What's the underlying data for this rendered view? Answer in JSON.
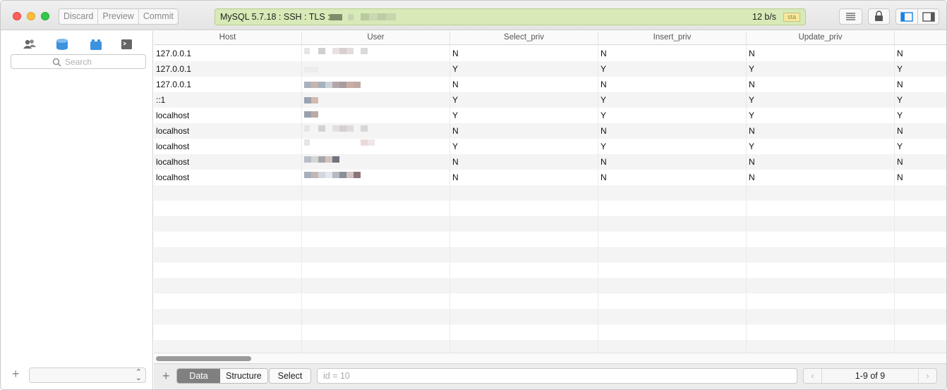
{
  "toolbar": {
    "discard": "Discard",
    "preview": "Preview",
    "commit": "Commit"
  },
  "status": {
    "connection": "MySQL 5.7.18 : SSH : TLS :",
    "speed": "12 b/s",
    "badge": "sta"
  },
  "sidebar": {
    "search_placeholder": "Search",
    "icons": [
      "users-icon",
      "database-icon",
      "lego-icon",
      "terminal-icon"
    ]
  },
  "table": {
    "columns": [
      "Host",
      "User",
      "Select_priv",
      "Insert_priv",
      "Update_priv"
    ],
    "rows": [
      {
        "host": "127.0.0.1",
        "select": "N",
        "insert": "N",
        "update": "N",
        "next": "N"
      },
      {
        "host": "127.0.0.1",
        "select": "Y",
        "insert": "Y",
        "update": "Y",
        "next": "Y"
      },
      {
        "host": "127.0.0.1",
        "select": "N",
        "insert": "N",
        "update": "N",
        "next": "N"
      },
      {
        "host": "::1",
        "select": "Y",
        "insert": "Y",
        "update": "Y",
        "next": "Y"
      },
      {
        "host": "localhost",
        "select": "Y",
        "insert": "Y",
        "update": "Y",
        "next": "Y"
      },
      {
        "host": "localhost",
        "select": "N",
        "insert": "N",
        "update": "N",
        "next": "N"
      },
      {
        "host": "localhost",
        "select": "Y",
        "insert": "Y",
        "update": "Y",
        "next": "Y"
      },
      {
        "host": "localhost",
        "select": "N",
        "insert": "N",
        "update": "N",
        "next": "N"
      },
      {
        "host": "localhost",
        "select": "N",
        "insert": "N",
        "update": "N",
        "next": "N"
      }
    ]
  },
  "bottombar": {
    "tab_data": "Data",
    "tab_structure": "Structure",
    "select_button": "Select",
    "filter_placeholder": "id = 10",
    "page_count": "1-9 of 9"
  },
  "colors": {
    "status_bg": "#d7eab7",
    "active_tab": "#808080",
    "accent_blue": "#1a82e2"
  }
}
